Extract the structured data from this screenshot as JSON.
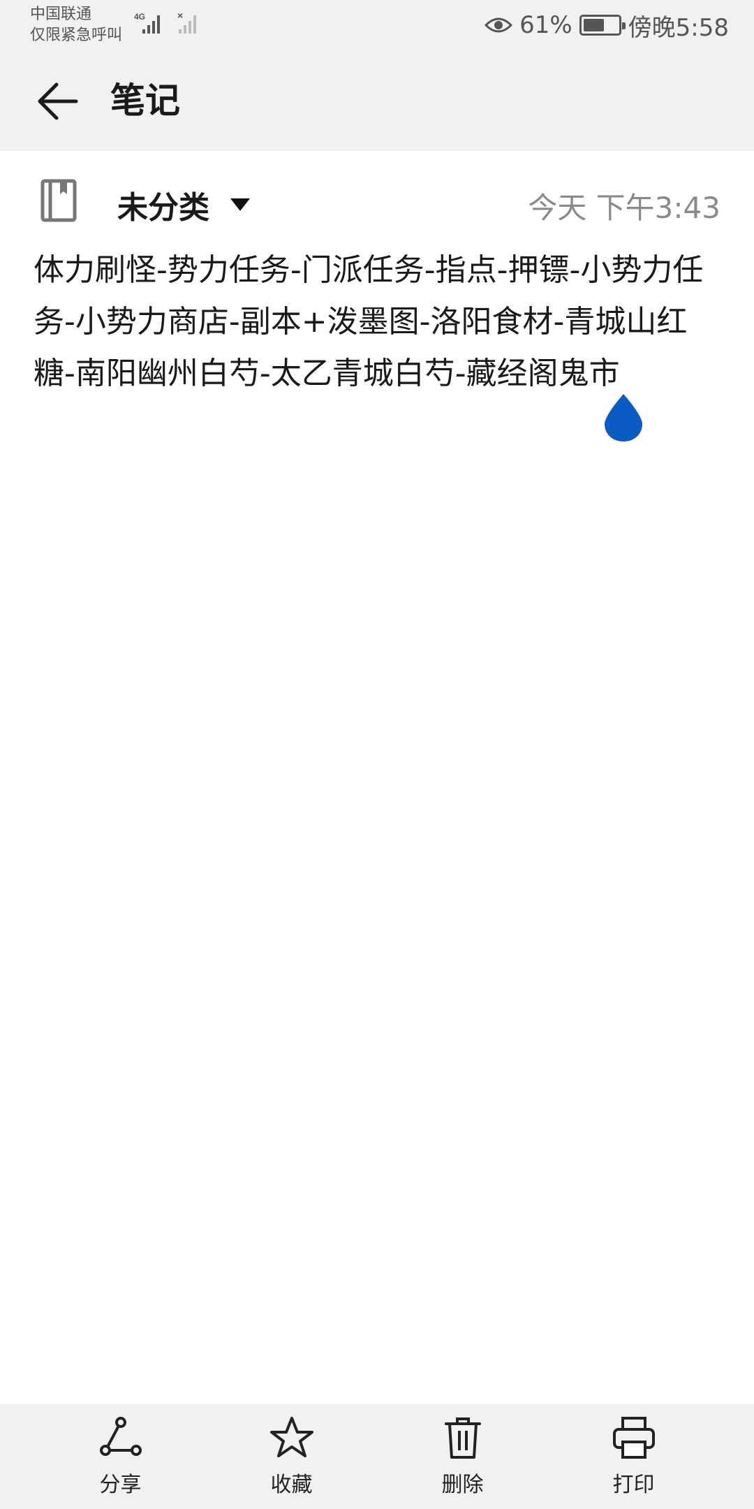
{
  "status_bar": {
    "carrier_line1": "中国联通",
    "carrier_line2": "仅限紧急呼叫",
    "network_type": "4G",
    "battery_percent": "61%",
    "battery_level": 0.61,
    "time": "傍晚5:58",
    "icons": [
      "signal-icon",
      "no-signal-icon",
      "eye-icon",
      "battery-icon"
    ]
  },
  "header": {
    "title": "笔记",
    "back_icon": "back-arrow-icon"
  },
  "meta": {
    "category": "未分类",
    "timestamp": "今天 下午3:43",
    "notebook_icon": "notebook-icon"
  },
  "note": {
    "content": "体力刷怪-势力任务-门派任务-指点-押镖-小势力任务-小势力商店-副本+泼墨图-洛阳食材-青城山红糖-南阳幽州白芍-太乙青城白芍-藏经阁鬼市"
  },
  "toolbar": {
    "items": [
      {
        "label": "分享",
        "icon": "share-icon"
      },
      {
        "label": "收藏",
        "icon": "star-icon"
      },
      {
        "label": "删除",
        "icon": "trash-icon"
      },
      {
        "label": "打印",
        "icon": "printer-icon"
      }
    ]
  },
  "colors": {
    "background": "#ffffff",
    "chrome": "#f1f1f1",
    "cursor_handle": "#0a5bc4",
    "muted_text": "#8a8a8a"
  }
}
